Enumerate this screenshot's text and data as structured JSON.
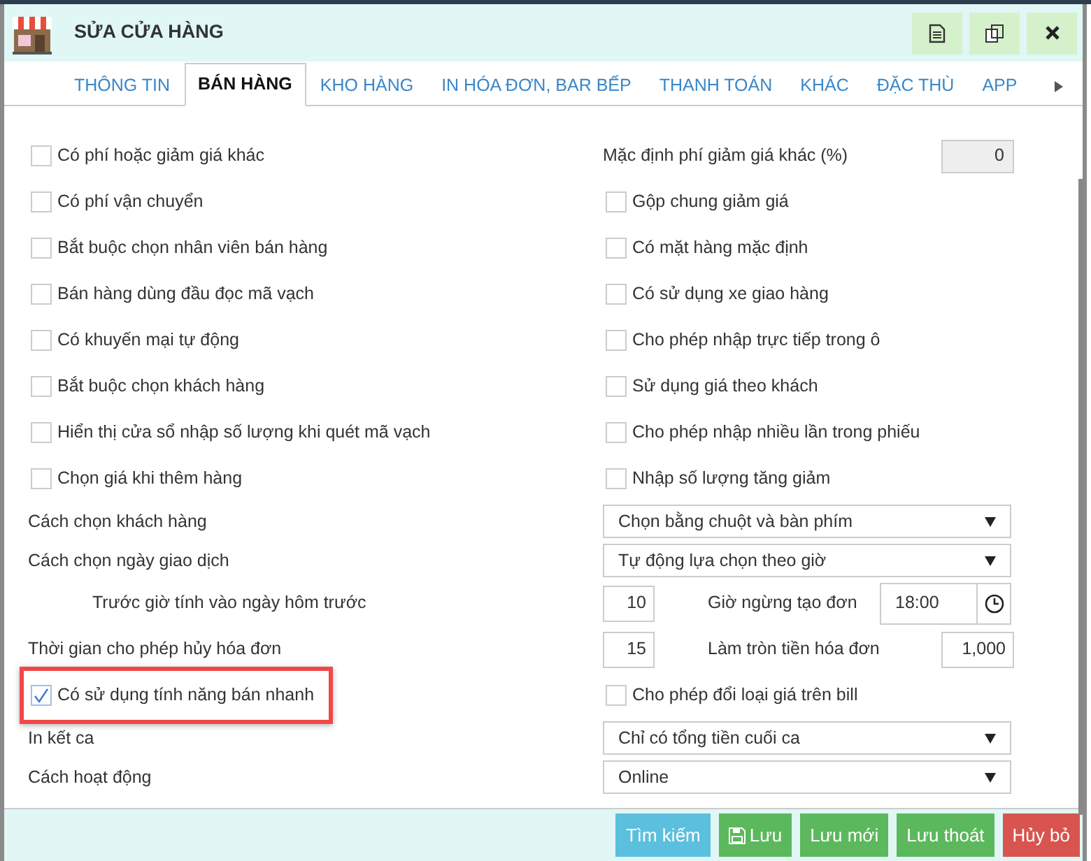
{
  "window": {
    "title": "SỬA CỬA HÀNG"
  },
  "title_buttons": [
    {
      "kind": "document"
    },
    {
      "kind": "copy"
    },
    {
      "kind": "close"
    }
  ],
  "tabs": [
    {
      "label": "THÔNG TIN",
      "selected": false
    },
    {
      "label": "BÁN HÀNG",
      "selected": true
    },
    {
      "label": "KHO HÀNG",
      "selected": false
    },
    {
      "label": "IN HÓA ĐƠN, BAR BẾP",
      "selected": false
    },
    {
      "label": "THANH TOÁN",
      "selected": false
    },
    {
      "label": "KHÁC",
      "selected": false
    },
    {
      "label": "ĐẶC THÙ",
      "selected": false
    },
    {
      "label": "APP",
      "selected": false
    }
  ],
  "rows": [
    {
      "left": {
        "kind": "checkbox",
        "label": "Có phí hoặc giảm giá khác",
        "checked": false,
        "highlighted": false
      },
      "right": {
        "kind": "number",
        "label": "Mặc định phí giảm giá khác (%)",
        "value": "0"
      }
    },
    {
      "left": {
        "kind": "checkbox",
        "label": "Có phí vận chuyển",
        "checked": false,
        "highlighted": false
      },
      "right": {
        "kind": "checkbox",
        "label": "Gộp chung giảm giá",
        "checked": false
      }
    },
    {
      "left": {
        "kind": "checkbox",
        "label": "Bắt buộc chọn nhân viên bán hàng",
        "checked": false,
        "highlighted": false
      },
      "right": {
        "kind": "checkbox",
        "label": "Có mặt hàng mặc định",
        "checked": false
      }
    },
    {
      "left": {
        "kind": "checkbox",
        "label": "Bán hàng dùng đầu đọc mã vạch",
        "checked": false,
        "highlighted": false
      },
      "right": {
        "kind": "checkbox",
        "label": "Có sử dụng xe giao hàng",
        "checked": false
      }
    },
    {
      "left": {
        "kind": "checkbox",
        "label": "Có khuyến mại tự động",
        "checked": false,
        "highlighted": false
      },
      "right": {
        "kind": "checkbox",
        "label": "Cho phép nhập trực tiếp trong ô",
        "checked": false
      }
    },
    {
      "left": {
        "kind": "checkbox",
        "label": "Bắt buộc chọn khách hàng",
        "checked": false,
        "highlighted": false
      },
      "right": {
        "kind": "checkbox",
        "label": "Sử dụng giá theo khách",
        "checked": false
      }
    },
    {
      "left": {
        "kind": "checkbox",
        "label": "Hiển thị cửa sổ nhập số lượng khi quét mã vạch",
        "checked": false,
        "highlighted": false
      },
      "right": {
        "kind": "checkbox",
        "label": "Cho phép nhập nhiều lần trong phiếu",
        "checked": false
      }
    },
    {
      "left": {
        "kind": "checkbox",
        "label": "Chọn giá khi thêm hàng",
        "checked": false,
        "highlighted": false
      },
      "right": {
        "kind": "checkbox",
        "label": "Nhập số lượng tăng giảm",
        "checked": false
      }
    },
    {
      "left": {
        "kind": "label",
        "label": "Cách chọn khách hàng"
      },
      "right": {
        "kind": "select",
        "value": "Chọn bằng chuột và bàn phím"
      }
    },
    {
      "left": {
        "kind": "label",
        "label": "Cách chọn ngày giao dịch"
      },
      "right": {
        "kind": "select",
        "value": "Tự động lựa chọn theo giờ"
      }
    },
    {
      "left": {
        "kind": "sublabel",
        "label": "Trước giờ tính vào ngày hôm trước"
      },
      "right": {
        "kind": "time-pair",
        "value": "10",
        "label": "Giờ ngừng tạo đơn",
        "time": "18:00"
      }
    },
    {
      "left": {
        "kind": "label",
        "label": "Thời gian cho phép hủy hóa đơn"
      },
      "right": {
        "kind": "number-pair",
        "value": "15",
        "label": "Làm tròn tiền hóa đơn",
        "amount": "1,000"
      }
    },
    {
      "left": {
        "kind": "checkbox",
        "label": "Có sử dụng tính năng bán nhanh",
        "checked": true,
        "highlighted": true
      },
      "right": {
        "kind": "checkbox",
        "label": "Cho phép đổi loại giá trên bill",
        "checked": false
      }
    },
    {
      "left": {
        "kind": "label",
        "label": "In kết ca"
      },
      "right": {
        "kind": "select",
        "value": "Chỉ có tổng tiền cuối ca"
      }
    },
    {
      "left": {
        "kind": "label",
        "label": "Cách hoạt động"
      },
      "right": {
        "kind": "select",
        "value": "Online"
      }
    }
  ],
  "buttons": [
    {
      "label": "Tìm kiếm",
      "kind": "info"
    },
    {
      "label": "Lưu",
      "kind": "save"
    },
    {
      "label": "Lưu mới",
      "kind": "success"
    },
    {
      "label": "Lưu thoát",
      "kind": "success"
    },
    {
      "label": "Hủy bỏ",
      "kind": "danger"
    }
  ]
}
